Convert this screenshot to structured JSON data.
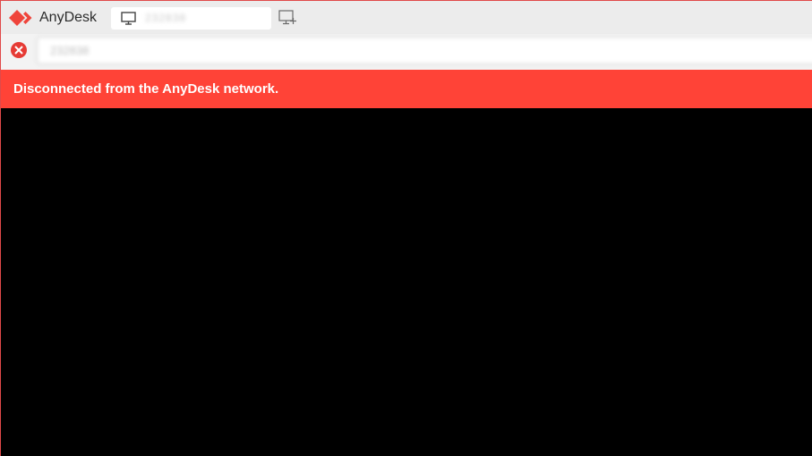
{
  "app": {
    "name": "AnyDesk",
    "brand_color": "#ef443b"
  },
  "tab": {
    "label": "232838",
    "icon": "monitor-icon"
  },
  "new_tab": {
    "icon": "new-session-icon"
  },
  "address_bar": {
    "status_icon": "disconnected-icon",
    "status_color": "#e63b35",
    "value": "232838"
  },
  "banner": {
    "message": "Disconnected from the AnyDesk network.",
    "color": "#ff4337"
  },
  "remote_view": {
    "background": "#000000"
  }
}
